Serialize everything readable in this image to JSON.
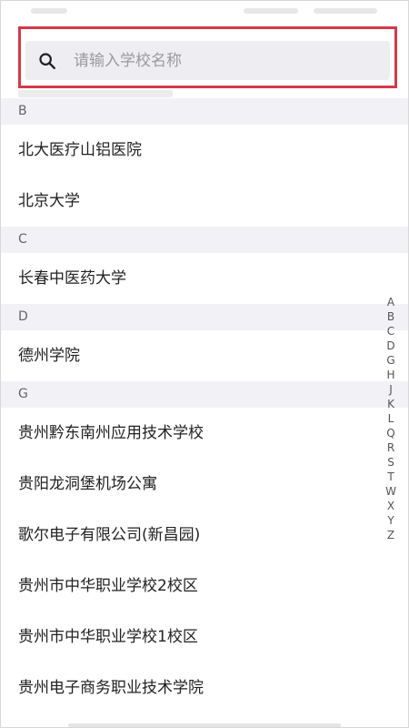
{
  "search": {
    "placeholder": "请输入学校名称",
    "icon": "search-icon"
  },
  "sections": [
    {
      "letter": "B",
      "items": [
        "北大医疗山铝医院",
        "北京大学"
      ]
    },
    {
      "letter": "C",
      "items": [
        "长春中医药大学"
      ]
    },
    {
      "letter": "D",
      "items": [
        "德州学院"
      ]
    },
    {
      "letter": "G",
      "items": [
        "贵州黔东南州应用技术学校",
        "贵阳龙洞堡机场公寓",
        "歌尔电子有限公司(新昌园)",
        "贵州市中华职业学校2校区",
        "贵州市中华职业学校1校区",
        "贵州电子商务职业技术学院"
      ]
    }
  ],
  "index_letters": [
    "A",
    "B",
    "C",
    "D",
    "G",
    "H",
    "J",
    "K",
    "L",
    "Q",
    "R",
    "S",
    "T",
    "W",
    "X",
    "Y",
    "Z"
  ],
  "colors": {
    "highlight_border": "#d33a4b",
    "section_bg": "#f2f2f6",
    "search_bg": "#eeeef2"
  }
}
